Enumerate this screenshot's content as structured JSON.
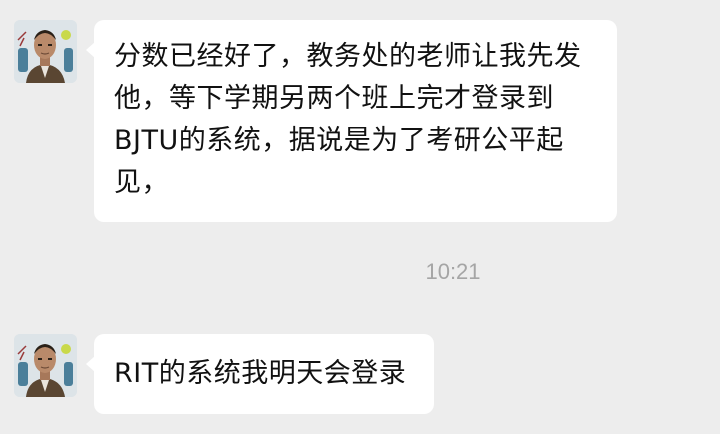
{
  "chat": {
    "messages": [
      {
        "sender": "other",
        "avatar_icon": "contact-avatar-portrait",
        "text": "分数已经好了，教务处的老师让我先发他，等下学期另两个班上完才登录到BJTU的系统，据说是为了考研公平起见，"
      },
      {
        "sender": "other",
        "avatar_icon": "contact-avatar-portrait",
        "text": "RIT的系统我明天会登录"
      }
    ],
    "timestamp": "10:21"
  },
  "colors": {
    "background": "#ededed",
    "bubble": "#ffffff",
    "text": "#111111",
    "timestamp": "#a5a5a5"
  }
}
